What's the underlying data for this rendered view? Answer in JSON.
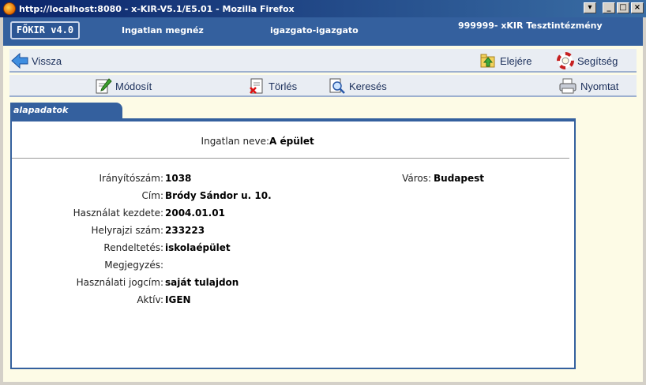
{
  "window": {
    "title": "http://localhost:8080 - x-KIR-V5.1/E5.01 - Mozilla Firefox",
    "buttons": {
      "dropdown": "▾",
      "minimize": "_",
      "maximize": "□",
      "close": "×"
    }
  },
  "header": {
    "logo": "FŐKIR v4.0",
    "page": "Ingatlan megnéz",
    "user": "igazgato-igazgato",
    "institution": "999999- xKIR Tesztintézmény"
  },
  "toolbar": {
    "back": "Vissza",
    "top": "Elejére",
    "help": "Segítség",
    "edit": "Módosít",
    "delete": "Törlés",
    "search": "Keresés",
    "print": "Nyomtat"
  },
  "tab": {
    "label": "alapadatok"
  },
  "property": {
    "name_label": "Ingatlan neve:",
    "name_value": "A épület",
    "fields": [
      {
        "label": "Irányítószám:",
        "value": "1038"
      },
      {
        "label": "Cím:",
        "value": "Bródy Sándor u. 10."
      },
      {
        "label": "Használat kezdete:",
        "value": "2004.01.01"
      },
      {
        "label": "Helyrajzi szám:",
        "value": "233223"
      },
      {
        "label": "Rendeltetés:",
        "value": "iskolaépület"
      },
      {
        "label": "Megjegyzés:",
        "value": ""
      },
      {
        "label": "Használati jogcím:",
        "value": "saját tulajdon"
      },
      {
        "label": "Aktív:",
        "value": "IGEN"
      }
    ],
    "city_label": "Város:",
    "city_value": "Budapest"
  },
  "colors": {
    "header": "#34609e",
    "toolbar_bg": "#e9edf3",
    "page_bg": "#fdfbe6"
  }
}
